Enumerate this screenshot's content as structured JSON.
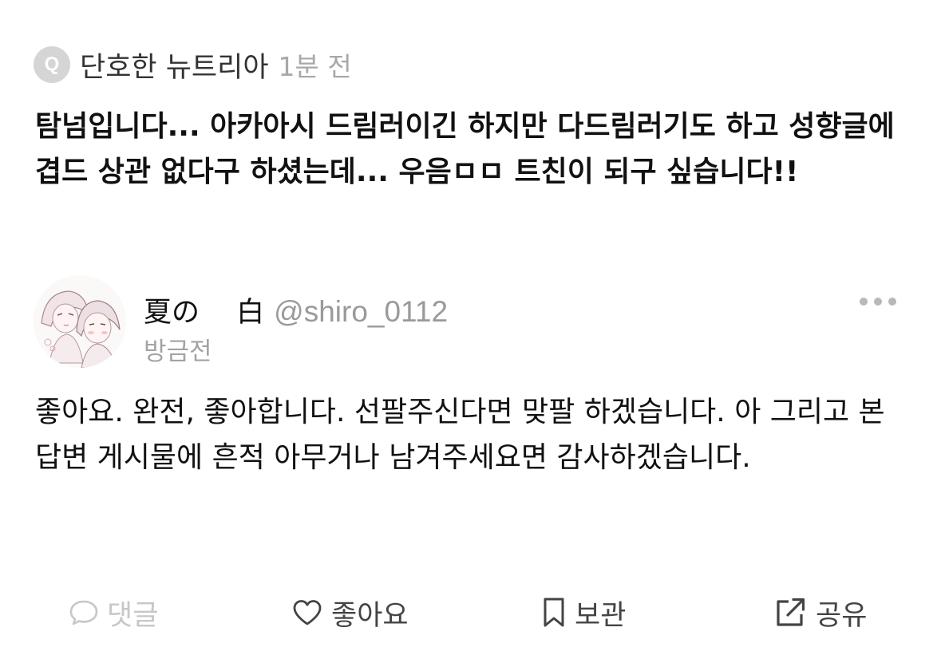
{
  "question": {
    "badge_letter": "Q",
    "asker_name": "단호한 뉴트리아",
    "time": "1분 전",
    "text": "탐넘입니다... 아카아시 드림러이긴 하지만 다드림러기도 하고 성향글에 겹드 상관 없다구 하셨는데... 우음ㅁㅁ 트친이 되구 싶습니다!!"
  },
  "answer": {
    "author_name": "夏の　 白",
    "author_handle": "@shiro_0112",
    "time": "방금전",
    "avatar_icon": "illustrated-profile-avatar",
    "more_icon": "more-dots-icon",
    "text": "좋아요. 완전, 좋아합니다. 선팔주신다면 맞팔 하겠습니다. 아 그리고 본 답변 게시물에 흔적 아무거나 남겨주세요면 감사하겠습니다."
  },
  "actions": {
    "comment": {
      "label": "댓글",
      "icon": "speech-bubble-icon",
      "enabled": false
    },
    "like": {
      "label": "좋아요",
      "icon": "heart-icon",
      "enabled": true
    },
    "save": {
      "label": "보관",
      "icon": "bookmark-icon",
      "enabled": true
    },
    "share": {
      "label": "공유",
      "icon": "share-arrow-icon",
      "enabled": true
    }
  },
  "colors": {
    "text_primary": "#111111",
    "text_secondary": "#9a9a9a",
    "badge_bg": "#d5d5d5",
    "disabled": "#c7c7c7",
    "action_text": "#444444"
  }
}
